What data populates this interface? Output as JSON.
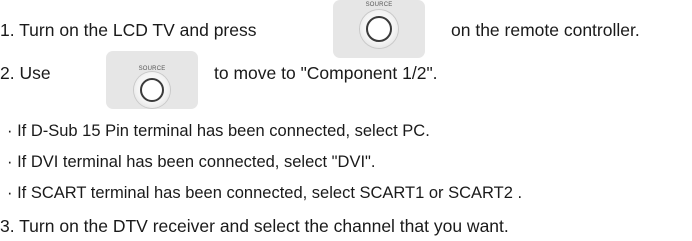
{
  "steps": {
    "step1_before": "1. Turn on the LCD TV and press",
    "step1_after": "on the remote controller.",
    "step2_before": "2. Use",
    "step2_after": "to move to \"Component 1/2\".",
    "bullets": [
      "· If D-Sub 15 Pin terminal has been connected, select PC.",
      "· If DVI terminal has been connected, select \"DVI\".",
      "· If SCART terminal has been connected, select SCART1 or SCART2 ."
    ],
    "step3": "3. Turn on the DTV receiver and select the channel that you want."
  },
  "source_button": {
    "label": "SOURCE",
    "icon": "source-button-icon"
  },
  "colors": {
    "text": "#1a1a1a",
    "button_bg": "#e6e6e6"
  }
}
